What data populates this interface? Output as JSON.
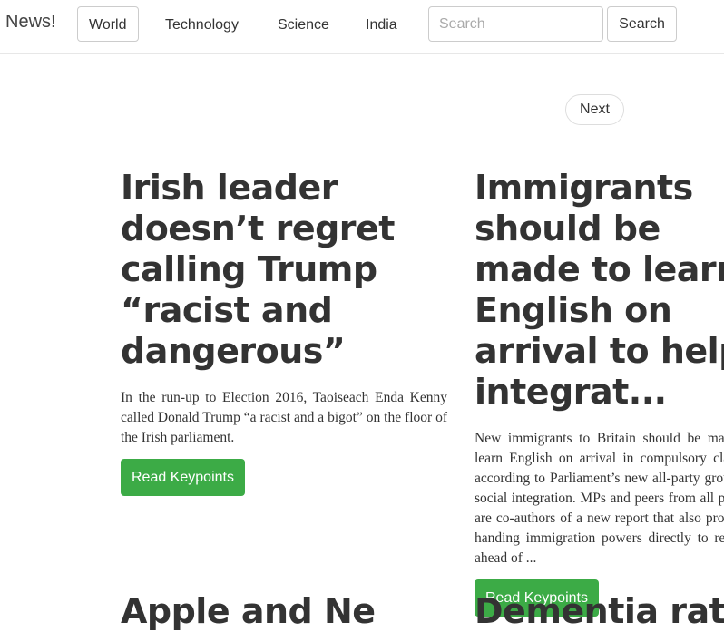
{
  "navbar": {
    "brand": "News!",
    "links": [
      "World",
      "Technology",
      "Science",
      "India"
    ],
    "search_placeholder": "Search",
    "search_button": "Search"
  },
  "pager": {
    "next_label": "Next"
  },
  "articles": [
    {
      "title": "Irish leader doesn’t regret calling Trump “racist and dangerous”",
      "summary": "In the run-up to Election 2016, Taoiseach Enda Kenny called Donald Trump “a racist and a bigot” on the floor of the Irish parliament.",
      "button": "Read Keypoints"
    },
    {
      "title": "Immigrants should be made to learn English on arrival to help integrat...",
      "summary": "New immigrants to Britain should be made to learn English on arrival in compulsory classes, according to Parliament’s new all-party group on social integration. MPs and peers from all parties are co-authors of a new report that also proposes handing immigration powers directly to regions ahead of ...",
      "button": "Read Keypoints"
    }
  ],
  "next_row_titles": [
    "Apple and Ne",
    "Dementia rate"
  ],
  "colors": {
    "accent_green": "#3cab46"
  }
}
